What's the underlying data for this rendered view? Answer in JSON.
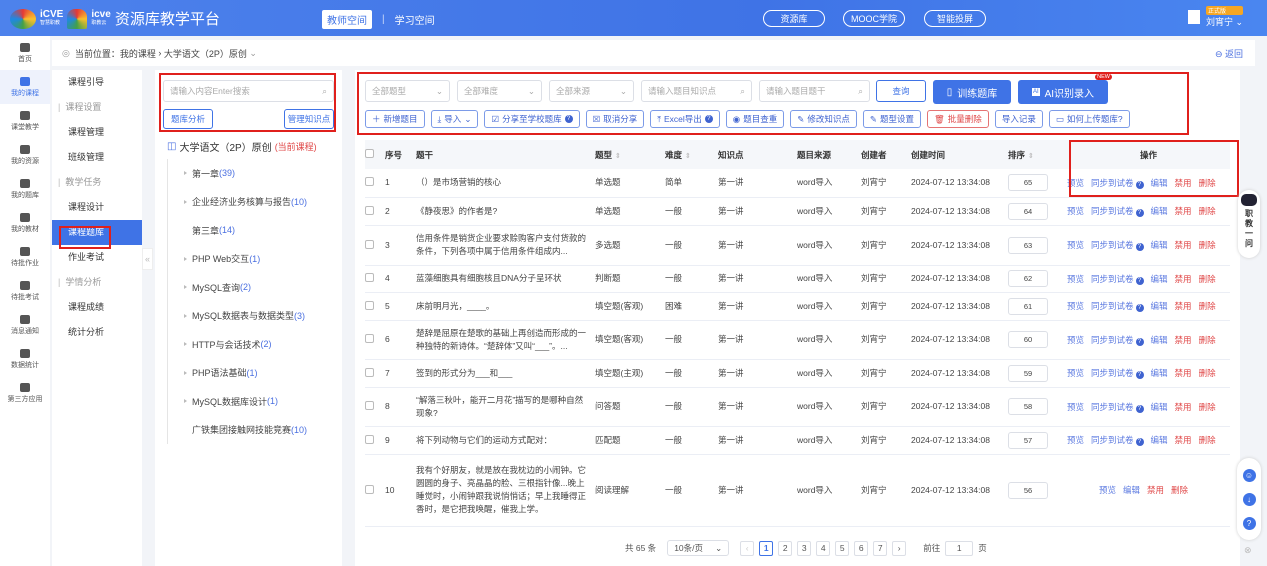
{
  "header": {
    "logo1": "iCVE",
    "logo1_sub": "智慧职教",
    "logo2": "icve",
    "logo2_sub": "职教云",
    "platform": "资源库教学平台",
    "tabs": [
      {
        "label": "教师空间",
        "active": true
      },
      {
        "label": "学习空间",
        "active": false
      }
    ],
    "links": [
      "资源库",
      "MOOC学院",
      "智能投屏"
    ],
    "badge": "正式版",
    "user": "刘宵宁"
  },
  "icon_sidebar": [
    {
      "label": "首页",
      "icon": "home-icon"
    },
    {
      "label": "我的课程",
      "icon": "book-icon",
      "active": true
    },
    {
      "label": "课堂教学",
      "icon": "play-icon"
    },
    {
      "label": "我的资源",
      "icon": "resource-icon"
    },
    {
      "label": "我的题库",
      "icon": "question-bank-icon"
    },
    {
      "label": "我的教材",
      "icon": "textbook-icon"
    },
    {
      "label": "待批作业",
      "icon": "homework-icon"
    },
    {
      "label": "待批考试",
      "icon": "exam-icon"
    },
    {
      "label": "消息通知",
      "icon": "message-icon"
    },
    {
      "label": "数据统计",
      "icon": "chart-icon"
    },
    {
      "label": "第三方应用",
      "icon": "apps-icon"
    }
  ],
  "breadcrumb": {
    "prefix": "当前位置：",
    "items": [
      "我的课程",
      "大学语文（2P）原创"
    ],
    "back": "返回"
  },
  "menu": [
    {
      "label": "课程引导"
    },
    {
      "label": "课程设置",
      "group": true
    },
    {
      "label": "课程管理"
    },
    {
      "label": "班级管理"
    },
    {
      "label": "教学任务",
      "group": true
    },
    {
      "label": "课程设计"
    },
    {
      "label": "课程题库",
      "active": true
    },
    {
      "label": "作业考试"
    },
    {
      "label": "学情分析",
      "group": true
    },
    {
      "label": "课程成绩"
    },
    {
      "label": "统计分析"
    }
  ],
  "tree": {
    "search_placeholder": "请输入内容Enter搜索",
    "analysis_btn": "题库分析",
    "manage_btn": "管理知识点",
    "root": "大学语文（2P）原创",
    "root_tag": "(当前课程)",
    "nodes": [
      {
        "label": "第一章",
        "count": "(39)",
        "arrow": true
      },
      {
        "label": "企业经济业务核算与报告",
        "count": "(10)",
        "arrow": true
      },
      {
        "label": "第三章",
        "count": "(14)",
        "arrow": false
      },
      {
        "label": "PHP Web交互",
        "count": "(1)",
        "arrow": true
      },
      {
        "label": "MySQL查询",
        "count": "(2)",
        "arrow": true
      },
      {
        "label": "MySQL数据表与数据类型",
        "count": "(3)",
        "arrow": true
      },
      {
        "label": "HTTP与会话技术",
        "count": "(2)",
        "arrow": true
      },
      {
        "label": "PHP语法基础",
        "count": "(1)",
        "arrow": true
      },
      {
        "label": "MySQL数据库设计",
        "count": "(1)",
        "arrow": true
      },
      {
        "label": "广铁集团接触网技能竞赛",
        "count": "(10)",
        "arrow": false
      }
    ]
  },
  "filters": {
    "type": "全部题型",
    "difficulty": "全部难度",
    "source": "全部来源",
    "kp_placeholder": "请输入题目知识点",
    "stem_placeholder": "请输入题目题干",
    "query": "查询",
    "train": "训练题库",
    "ai": "AI识别录入",
    "new_badge": "NEW"
  },
  "toolbar": [
    "新增题目",
    "导入",
    "分享至学校题库",
    "取消分享",
    "Excel导出",
    "题目查重",
    "修改知识点",
    "题型设置",
    "批量删除",
    "导入记录",
    "如何上传题库?"
  ],
  "table": {
    "headers": [
      "序号",
      "题干",
      "题型",
      "难度",
      "知识点",
      "题目来源",
      "创建者",
      "创建时间",
      "排序",
      "操作"
    ],
    "rows": [
      {
        "no": "1",
        "stem": "（）是市场营销的核心",
        "type": "单选题",
        "diff": "简单",
        "kp": "第一讲",
        "src": "word导入",
        "creator": "刘宵宁",
        "time": "2024-07-12 13:34:08",
        "order": "65",
        "sync": true
      },
      {
        "no": "2",
        "stem": "《静夜思》的作者是?",
        "type": "单选题",
        "diff": "一般",
        "kp": "第一讲",
        "src": "word导入",
        "creator": "刘宵宁",
        "time": "2024-07-12 13:34:08",
        "order": "64",
        "sync": true
      },
      {
        "no": "3",
        "stem": "信用条件是销货企业要求赊购客户支付货款的条件，下列各项中属于信用条件组成内...",
        "type": "多选题",
        "diff": "一般",
        "kp": "第一讲",
        "src": "word导入",
        "creator": "刘宵宁",
        "time": "2024-07-12 13:34:08",
        "order": "63",
        "sync": true
      },
      {
        "no": "4",
        "stem": "蓝藻细胞具有细胞核且DNA分子呈环状",
        "type": "判断题",
        "diff": "一般",
        "kp": "第一讲",
        "src": "word导入",
        "creator": "刘宵宁",
        "time": "2024-07-12 13:34:08",
        "order": "62",
        "sync": true
      },
      {
        "no": "5",
        "stem": "床前明月光，____。",
        "type": "填空题(客观)",
        "diff": "困难",
        "kp": "第一讲",
        "src": "word导入",
        "creator": "刘宵宁",
        "time": "2024-07-12 13:34:08",
        "order": "61",
        "sync": true
      },
      {
        "no": "6",
        "stem": "楚辞是屈原在楚歌的基础上再创造而形成的一种独特的新诗体。“楚辞体”又叫“___”。...",
        "type": "填空题(客观)",
        "diff": "一般",
        "kp": "第一讲",
        "src": "word导入",
        "creator": "刘宵宁",
        "time": "2024-07-12 13:34:08",
        "order": "60",
        "sync": true
      },
      {
        "no": "7",
        "stem": "签到的形式分为___和___",
        "type": "填空题(主观)",
        "diff": "一般",
        "kp": "第一讲",
        "src": "word导入",
        "creator": "刘宵宁",
        "time": "2024-07-12 13:34:08",
        "order": "59",
        "sync": true
      },
      {
        "no": "8",
        "stem": "“解落三秋叶，能开二月花”描写的是哪种自然现象?",
        "type": "问答题",
        "diff": "一般",
        "kp": "第一讲",
        "src": "word导入",
        "creator": "刘宵宁",
        "time": "2024-07-12 13:34:08",
        "order": "58",
        "sync": true
      },
      {
        "no": "9",
        "stem": "将下列动物与它们的运动方式配对：",
        "type": "匹配题",
        "diff": "一般",
        "kp": "第一讲",
        "src": "word导入",
        "creator": "刘宵宁",
        "time": "2024-07-12 13:34:08",
        "order": "57",
        "sync": true
      },
      {
        "no": "10",
        "stem": "我有个好朋友，就是放在我枕边的小闹钟。它圆圆的身子、亮晶晶的脸、三根指针像...晚上睡觉时，小闹钟跟我说悄悄话；早上我睡得正香时，是它把我唤醒，催我上学。",
        "type": "阅读理解",
        "diff": "一般",
        "kp": "第一讲",
        "src": "word导入",
        "creator": "刘宵宁",
        "time": "2024-07-12 13:34:08",
        "order": "56",
        "sync": false
      }
    ],
    "ops": {
      "preview": "预览",
      "sync": "同步到试卷",
      "edit": "编辑",
      "disable": "禁用",
      "delete": "删除"
    }
  },
  "pagination": {
    "total": "共 65 条",
    "page_size": "10条/页",
    "pages": [
      "1",
      "2",
      "3",
      "4",
      "5",
      "6",
      "7"
    ],
    "current": "1",
    "goto": "前往",
    "goto_value": "1",
    "page_unit": "页"
  },
  "assistant": {
    "label": "职教一问"
  },
  "colors": {
    "primary": "#3f73e6",
    "danger": "#e04848",
    "highlight": "#e0201c"
  }
}
